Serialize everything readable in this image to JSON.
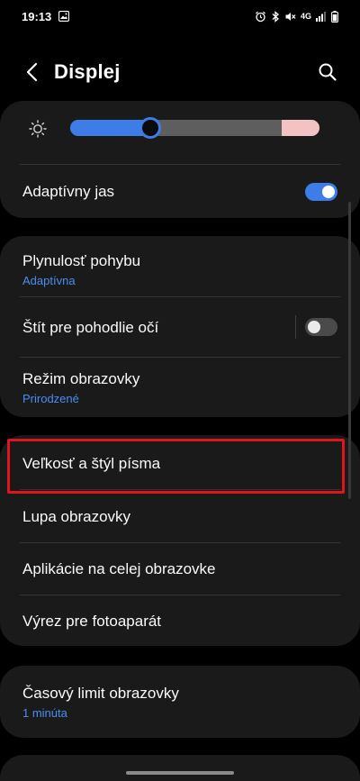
{
  "status_bar": {
    "time": "19:13",
    "network": "4G"
  },
  "header": {
    "title": "Displej"
  },
  "brightness": {
    "level": 0.32
  },
  "settings": {
    "adaptive_brightness": {
      "label": "Adaptívny jas",
      "enabled": true
    },
    "motion_smoothness": {
      "label": "Plynulosť pohybu",
      "value": "Adaptívna"
    },
    "eye_comfort": {
      "label": "Štít pre pohodlie očí",
      "enabled": false
    },
    "screen_mode": {
      "label": "Režim obrazovky",
      "value": "Prirodzené"
    },
    "font_size_style": {
      "label": "Veľkosť a štýl písma"
    },
    "screen_zoom": {
      "label": "Lupa obrazovky"
    },
    "full_screen_apps": {
      "label": "Aplikácie na celej obrazovke"
    },
    "camera_cutout": {
      "label": "Výrez pre fotoaparát"
    },
    "screen_timeout": {
      "label": "Časový limit obrazovky",
      "value": "1 minúta"
    }
  },
  "colors": {
    "accent": "#3e7ce8",
    "subtext": "#4a8df5",
    "card": "#1a1a1a",
    "highlight": "#e0141d"
  }
}
